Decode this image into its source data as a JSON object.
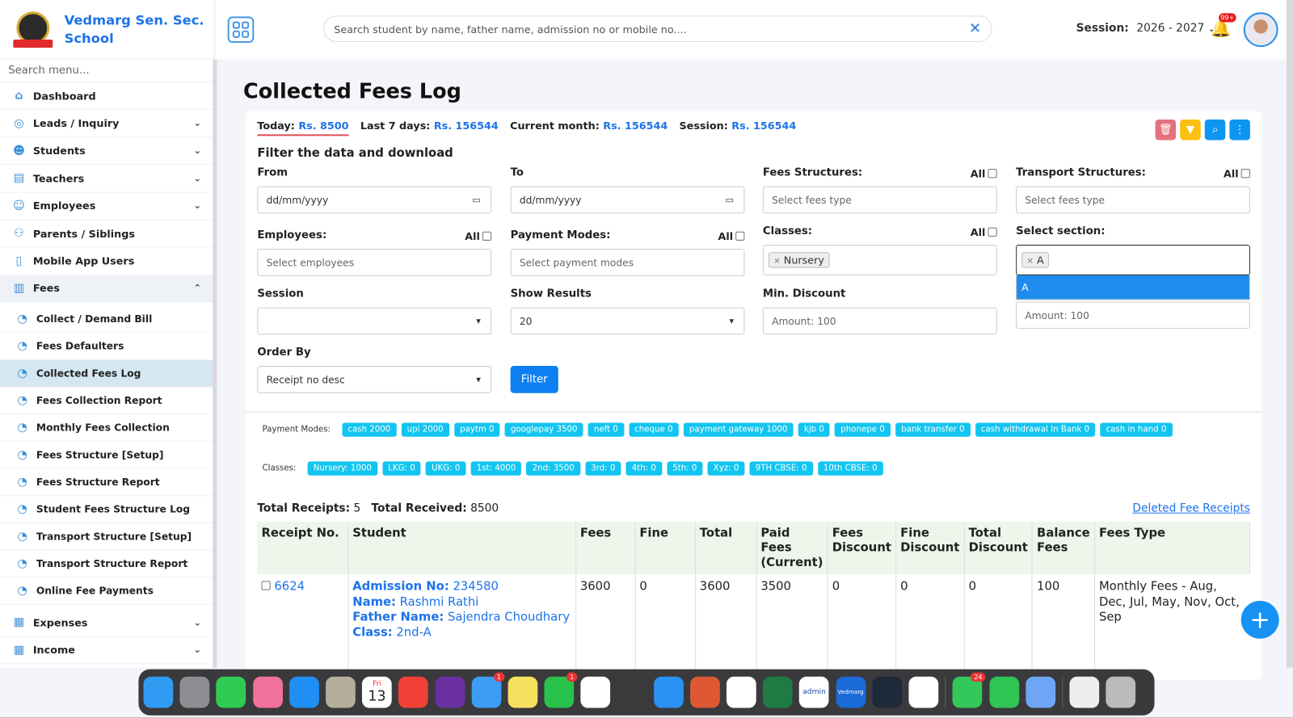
{
  "school": {
    "name_line1": "Vedmarg Sen. Sec.",
    "name_line2": "School"
  },
  "sidebar": {
    "search_placeholder": "Search menu...",
    "items": [
      {
        "label": "Dashboard",
        "icon": "home-icon",
        "chevron": ""
      },
      {
        "label": "Leads / Inquiry",
        "icon": "leads-icon",
        "chevron": "⌄"
      },
      {
        "label": "Students",
        "icon": "students-icon",
        "chevron": "⌄"
      },
      {
        "label": "Teachers",
        "icon": "teachers-icon",
        "chevron": "⌄"
      },
      {
        "label": "Employees",
        "icon": "employees-icon",
        "chevron": "⌄"
      },
      {
        "label": "Parents / Siblings",
        "icon": "parents-icon",
        "chevron": ""
      },
      {
        "label": "Mobile App Users",
        "icon": "mobile-icon",
        "chevron": ""
      },
      {
        "label": "Fees",
        "icon": "fees-icon",
        "chevron": "⌃"
      }
    ],
    "fees_sub": [
      "Collect / Demand Bill",
      "Fees Defaulters",
      "Collected Fees Log",
      "Fees Collection Report",
      "Monthly Fees Collection",
      "Fees Structure [Setup]",
      "Fees Structure Report",
      "Student Fees Structure Log",
      "Transport Structure [Setup]",
      "Transport Structure Report",
      "Online Fee Payments"
    ],
    "bottom": [
      {
        "label": "Expenses",
        "chevron": "⌄"
      },
      {
        "label": "Income",
        "chevron": "⌄"
      }
    ]
  },
  "header": {
    "search_placeholder": "Search student by name, father name, admission no or mobile no....",
    "session_label": "Session:",
    "session_value": "2026 - 2027",
    "notif_badge": "99+"
  },
  "page": {
    "title": "Collected Fees Log"
  },
  "stats": {
    "today_label": "Today:",
    "today": "Rs. 8500",
    "last7_label": "Last 7 days:",
    "last7": "Rs. 156544",
    "month_label": "Current month:",
    "month": "Rs. 156544",
    "session_label": "Session:",
    "session": "Rs. 156544"
  },
  "filter": {
    "title": "Filter the data and download",
    "all": "All",
    "from_label": "From",
    "from_value": "dd/mm/yyyy",
    "to_label": "To",
    "to_value": "dd/mm/yyyy",
    "fees_structures_label": "Fees Structures:",
    "fees_structures_ph": "Select fees type",
    "transport_label": "Transport Structures:",
    "transport_ph": "Select fees type",
    "employees_label": "Employees:",
    "employees_ph": "Select employees",
    "payment_modes_label": "Payment Modes:",
    "payment_modes_ph": "Select payment modes",
    "classes_label": "Classes:",
    "classes_chip": "Nursery",
    "section_label": "Select section:",
    "section_chip": "A",
    "section_option": "A",
    "session_label": "Session",
    "session_value": "",
    "show_label": "Show Results",
    "show_value": "20",
    "min_discount_label": "Min. Discount",
    "min_discount_ph": "Amount: 100",
    "max_discount_ph": "Amount: 100",
    "order_label": "Order By",
    "order_value": "Receipt no desc",
    "filter_button": "Filter"
  },
  "payment_modes": {
    "label": "Payment Modes:",
    "tags": [
      "cash 2000",
      "upi 2000",
      "paytm 0",
      "googlepay 3500",
      "neft 0",
      "cheque 0",
      "payment gateway 1000",
      "kjb 0",
      "phonepe 0",
      "bank transfer 0",
      "cash withdrawal In Bank 0",
      "cash in hand 0"
    ]
  },
  "classes": {
    "label": "Classes:",
    "tags": [
      "Nursery: 1000",
      "LKG: 0",
      "UKG: 0",
      "1st: 4000",
      "2nd: 3500",
      "3rd: 0",
      "4th: 0",
      "5th: 0",
      "Xyz: 0",
      "9TH CBSE: 0",
      "10th CBSE: 0"
    ]
  },
  "totals": {
    "receipts_label": "Total Receipts:",
    "receipts": "5",
    "received_label": "Total Received:",
    "received": "8500",
    "deleted_link": "Deleted Fee Receipts"
  },
  "table": {
    "headers": [
      "Receipt No.",
      "Student",
      "Fees",
      "Fine",
      "Total",
      "Paid Fees (Current)",
      "Fees Discount",
      "Fine Discount",
      "Total Discount",
      "Balance Fees",
      "Fees Type"
    ],
    "rows": [
      {
        "receipt": "6624",
        "adm_label": "Admission No:",
        "adm": "234580",
        "name_label": "Name:",
        "name": "Rashmi Rathi",
        "father_label": "Father Name:",
        "father": "Sajendra Choudhary",
        "class_label": "Class:",
        "class": "2nd-A",
        "fees": "3600",
        "fine": "0",
        "total": "3600",
        "paid": "3500",
        "fees_discount": "0",
        "fine_discount": "0",
        "total_discount": "0",
        "balance": "100",
        "fees_type": "Monthly Fees - Aug, Dec, Jul, May, Nov, Oct, Sep"
      }
    ]
  },
  "dock": {
    "calendar_day": "Fri",
    "calendar_date": "13",
    "mail_badge": "1",
    "whatsapp_badge": "1",
    "messages_badge": "24",
    "admin_label": "admin",
    "vedmarg_label": "Vedmarg"
  },
  "colors": {
    "accent": "#1d73e8",
    "tag": "#12c5f0",
    "button": "#0d7ff2"
  }
}
